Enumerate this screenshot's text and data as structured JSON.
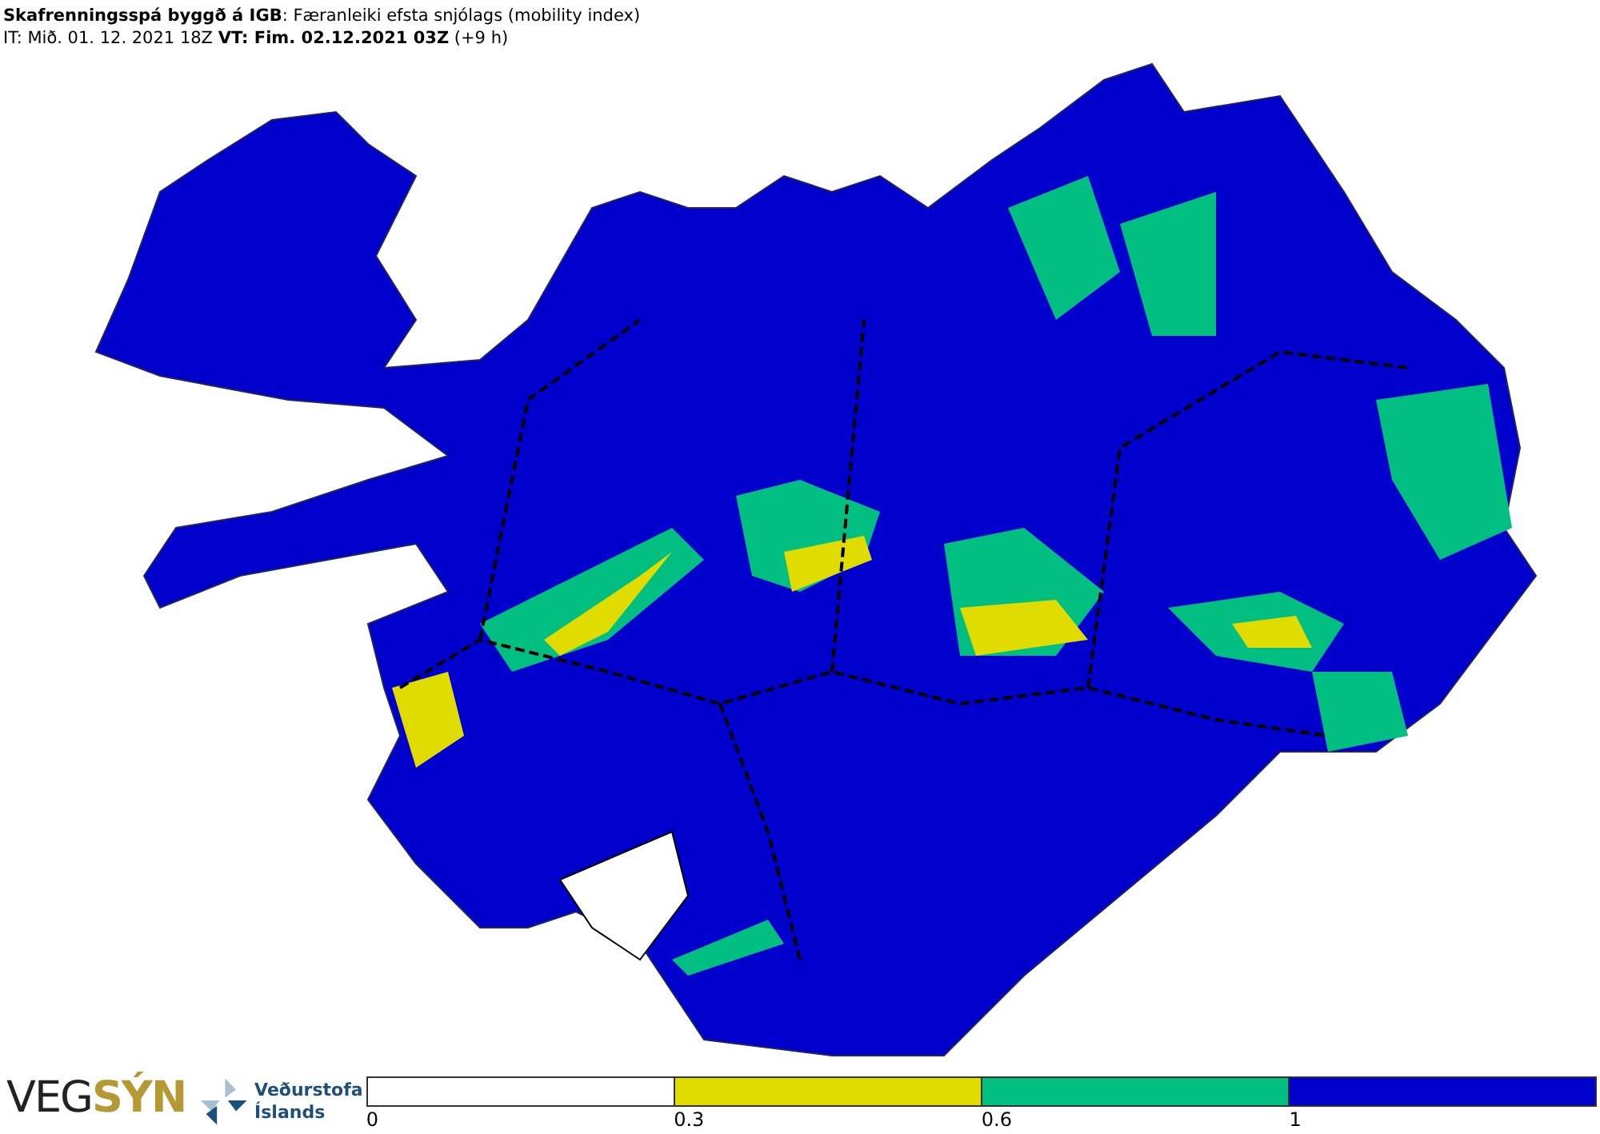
{
  "header": {
    "title": "**Skafrenningsspá byggð á IGB**: Færanleiki efsta snjólags (mobility index)",
    "times": "IT: Mið. 01. 12. 2021 18Z **VT: Fim. 02.12.2021 03Z** (+9 h)"
  },
  "vegsyn_logo": [
    "VEG",
    "SÝN"
  ],
  "agency_logo": [
    "Veðurstofa",
    "Íslands"
  ],
  "legend": {
    "segments": [
      {
        "color": "#ffffff",
        "tick": "0"
      },
      {
        "color": "#e0dc00",
        "tick": "0.3"
      },
      {
        "color": "#00bf80",
        "tick": "0.6"
      },
      {
        "color": "#0000cc",
        "tick": "1"
      }
    ]
  }
}
